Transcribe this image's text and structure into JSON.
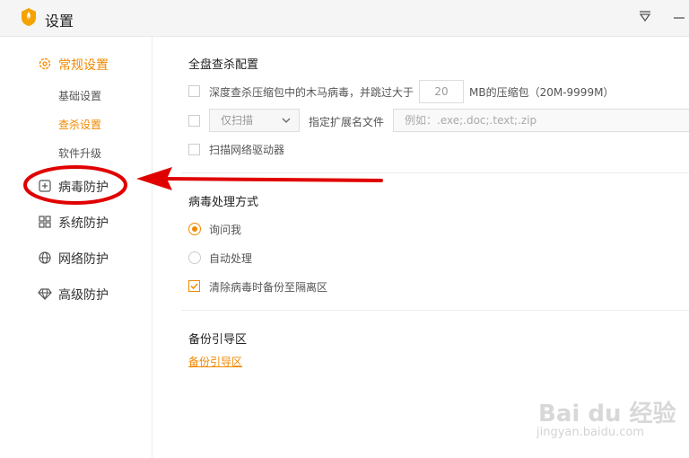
{
  "app": {
    "title": "设置"
  },
  "colors": {
    "accent": "#f08a00",
    "annotation": "#e00000"
  },
  "sidebar": {
    "items": [
      {
        "label": "常规设置",
        "icon": "gear-icon",
        "active": true
      },
      {
        "label": "病毒防护",
        "icon": "plus-square-icon",
        "active": false
      },
      {
        "label": "系统防护",
        "icon": "grid-icon",
        "active": false
      },
      {
        "label": "网络防护",
        "icon": "globe-icon",
        "active": false
      },
      {
        "label": "高级防护",
        "icon": "diamond-icon",
        "active": false
      }
    ],
    "subitems": [
      {
        "label": "基础设置",
        "active": false
      },
      {
        "label": "查杀设置",
        "active": true
      },
      {
        "label": "软件升级",
        "active": false
      }
    ]
  },
  "scan": {
    "title": "全盘查杀配置",
    "deep_scan_label": "深度查杀压缩包中的木马病毒，并跳过大于",
    "size_value": "20",
    "size_suffix": "MB的压缩包（20M-9999M）",
    "scan_mode_value": "仅扫描",
    "ext_label": "指定扩展名文件",
    "ext_placeholder": "例如：.exe;.doc;.text;.zip",
    "network_drive_label": "扫描网络驱动器"
  },
  "virus": {
    "title": "病毒处理方式",
    "options": [
      {
        "label": "询问我",
        "checked": true
      },
      {
        "label": "自动处理",
        "checked": false
      }
    ],
    "backup_label": "清除病毒时备份至隔离区",
    "backup_checked": true
  },
  "backup": {
    "title": "备份引导区",
    "link": "备份引导区"
  },
  "watermark": {
    "line1": "Bai du 经验",
    "line2": "jingyan.baidu.com"
  }
}
